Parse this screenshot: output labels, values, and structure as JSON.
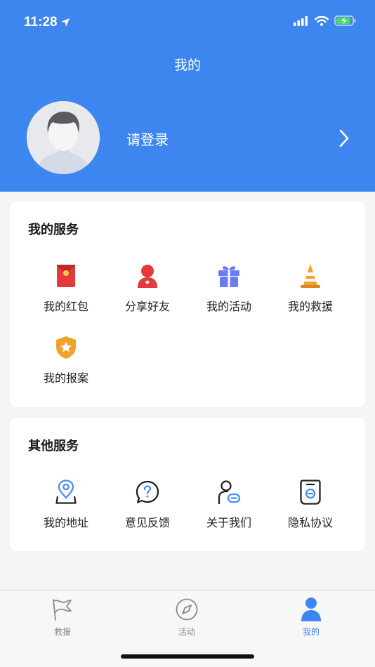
{
  "status_bar": {
    "time": "11:28"
  },
  "header": {
    "title": "我的",
    "login_label": "请登录"
  },
  "my_services": {
    "title": "我的服务",
    "items": [
      {
        "label": "我的红包",
        "icon": "red-envelope-icon"
      },
      {
        "label": "分享好友",
        "icon": "share-friend-icon"
      },
      {
        "label": "我的活动",
        "icon": "gift-icon"
      },
      {
        "label": "我的救援",
        "icon": "traffic-cone-icon"
      },
      {
        "label": "我的报案",
        "icon": "shield-star-icon"
      }
    ]
  },
  "other_services": {
    "title": "其他服务",
    "items": [
      {
        "label": "我的地址",
        "icon": "location-pin-icon"
      },
      {
        "label": "意见反馈",
        "icon": "question-bubble-icon"
      },
      {
        "label": "关于我们",
        "icon": "user-card-icon"
      },
      {
        "label": "隐私协议",
        "icon": "privacy-doc-icon"
      }
    ]
  },
  "tabbar": {
    "active_index": 2,
    "tabs": [
      {
        "label": "救援",
        "icon": "flag-icon"
      },
      {
        "label": "活动",
        "icon": "compass-icon"
      },
      {
        "label": "我的",
        "icon": "person-icon"
      }
    ]
  },
  "colors": {
    "primary": "#3d86ef",
    "background": "#f4f5f7",
    "red": "#e5393c",
    "orange": "#f2a22b",
    "purple_blue": "#6b7cf0"
  }
}
